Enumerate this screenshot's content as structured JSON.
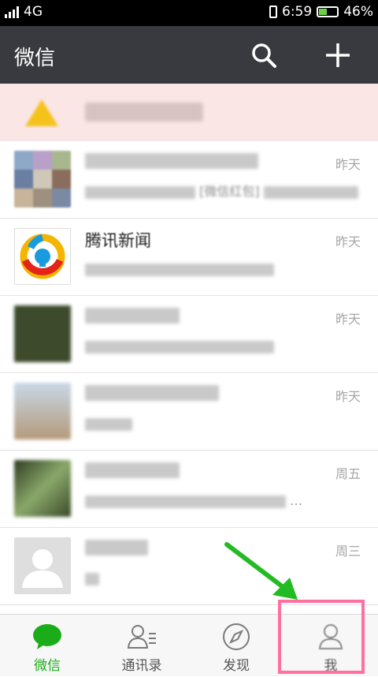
{
  "status_bar": {
    "network": "4G",
    "time": "6:59",
    "battery_percent": "46%",
    "battery_level": 0.46
  },
  "header": {
    "title": "微信",
    "search_icon": "search-icon",
    "add_icon": "plus-icon"
  },
  "notice": {
    "icon": "warning-icon"
  },
  "chats": [
    {
      "name": "",
      "preview": "[微信红包]",
      "time": "昨天",
      "avatar": "group-avatar"
    },
    {
      "name": "腾讯新闻",
      "preview": "",
      "time": "昨天",
      "avatar": "tencent-news-logo"
    },
    {
      "name": "",
      "preview": "",
      "time": "昨天",
      "avatar": "photo-avatar"
    },
    {
      "name": "",
      "preview": "",
      "time": "昨天",
      "avatar": "photo-avatar"
    },
    {
      "name": "",
      "preview": "…",
      "time": "周五",
      "avatar": "photo-avatar"
    },
    {
      "name": "",
      "preview": "",
      "time": "周三",
      "avatar": "default-avatar"
    }
  ],
  "tabs": [
    {
      "label": "微信",
      "icon": "chat-bubble-icon",
      "active": true
    },
    {
      "label": "通讯录",
      "icon": "contacts-icon",
      "active": false
    },
    {
      "label": "发现",
      "icon": "compass-icon",
      "active": false
    },
    {
      "label": "我",
      "icon": "person-icon",
      "active": false
    }
  ],
  "colors": {
    "accent": "#1aad19",
    "header_bg": "#393a3f",
    "annotation_arrow": "#22bb22",
    "annotation_box": "#ff6fa0"
  }
}
